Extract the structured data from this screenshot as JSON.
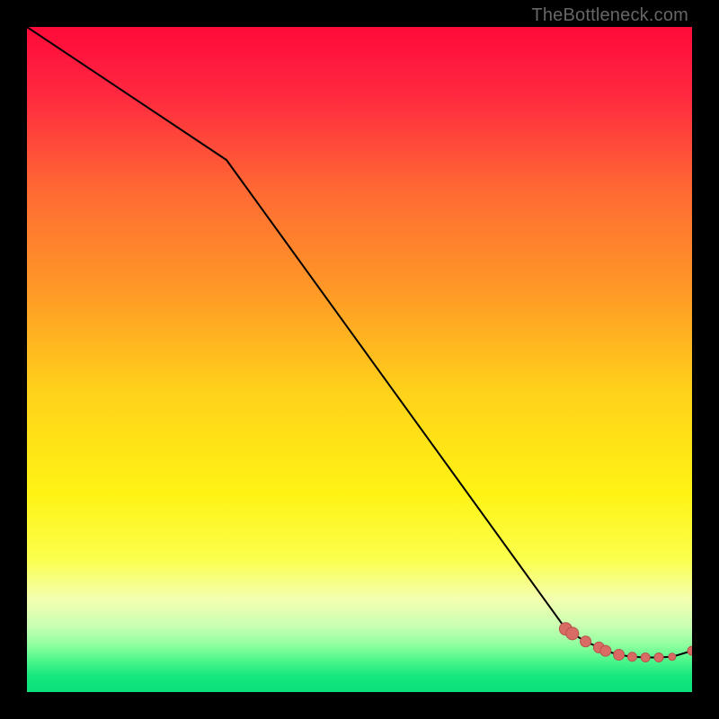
{
  "watermark": "TheBottleneck.com",
  "colors": {
    "background": "#000000",
    "gradient_stops": [
      {
        "offset": 0.0,
        "color": "#ff0a3a"
      },
      {
        "offset": 0.1,
        "color": "#ff2840"
      },
      {
        "offset": 0.25,
        "color": "#ff6b33"
      },
      {
        "offset": 0.4,
        "color": "#ff9a26"
      },
      {
        "offset": 0.55,
        "color": "#ffd21a"
      },
      {
        "offset": 0.7,
        "color": "#fff314"
      },
      {
        "offset": 0.8,
        "color": "#fbff4c"
      },
      {
        "offset": 0.86,
        "color": "#f4ffb0"
      },
      {
        "offset": 0.9,
        "color": "#caffb2"
      },
      {
        "offset": 0.93,
        "color": "#8dff9e"
      },
      {
        "offset": 0.955,
        "color": "#47f58a"
      },
      {
        "offset": 0.975,
        "color": "#17e77e"
      },
      {
        "offset": 1.0,
        "color": "#0ae07c"
      }
    ],
    "line": "#000000",
    "marker_fill": "#d86b63",
    "marker_stroke": "#b7534c",
    "watermark": "#666666"
  },
  "chart_data": {
    "type": "line",
    "title": "",
    "xlabel": "",
    "ylabel": "",
    "xlim": [
      0,
      100
    ],
    "ylim": [
      0,
      100
    ],
    "series": [
      {
        "name": "bottleneck-curve",
        "x": [
          0,
          30,
          81,
          82,
          84,
          86,
          87,
          89,
          91,
          93,
          95,
          97,
          100
        ],
        "y": [
          100,
          80,
          9.5,
          8.8,
          7.6,
          6.7,
          6.2,
          5.6,
          5.3,
          5.2,
          5.2,
          5.3,
          6.2
        ]
      }
    ],
    "markers": {
      "name": "highlighted-points",
      "x": [
        81,
        82,
        84,
        86,
        87,
        89,
        91,
        93,
        95,
        97,
        100
      ],
      "y": [
        9.5,
        8.8,
        7.6,
        6.7,
        6.2,
        5.6,
        5.3,
        5.2,
        5.2,
        5.3,
        6.2
      ],
      "size": [
        7,
        7,
        6,
        6,
        6,
        6,
        5,
        5,
        5,
        4,
        5
      ]
    }
  }
}
